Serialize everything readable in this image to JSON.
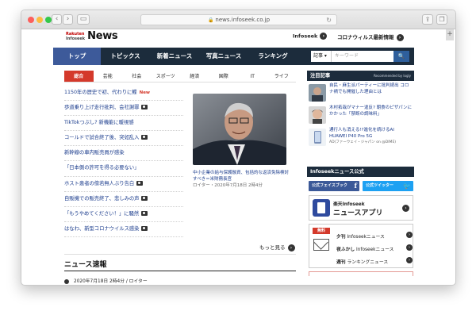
{
  "browser": {
    "url": "news.infoseek.co.jp",
    "back": "‹",
    "forward": "›",
    "reload": "↻",
    "new_tab": "+"
  },
  "header": {
    "logo_top": "Rakuten",
    "logo_bottom": "Infoseek",
    "logo_news": "News",
    "link_infoseek": "Infoseek",
    "link_corona": "コロナウィルス最新情報"
  },
  "gnav": {
    "items": [
      "トップ",
      "トピックス",
      "新着ニュース",
      "写真ニュース",
      "ランキング"
    ],
    "search_select": "記事 ▾",
    "search_placeholder": "キーワード",
    "search_button": "🔍"
  },
  "categories": [
    "総合",
    "芸能",
    "社会",
    "スポーツ",
    "経済",
    "国際",
    "IT",
    "ライフ"
  ],
  "articles": [
    {
      "title": "1150年の歴史で初、代わりに鰈",
      "camera": false,
      "new": "New"
    },
    {
      "title": "歩道乗り上げ走行批判、会社謝罪",
      "camera": true,
      "new": ""
    },
    {
      "title": "TikTokつぶし? 新機能に暖視感",
      "camera": false,
      "new": ""
    },
    {
      "title": "コールドで試合終了後、突如乱入",
      "camera": true,
      "new": ""
    },
    {
      "title": "新幹線の車内販売員が感染",
      "camera": false,
      "new": ""
    },
    {
      "title": "「日本側の許可を得る必要ない」",
      "camera": false,
      "new": ""
    },
    {
      "title": "ホスト患者の傍若無人ぶり告白",
      "camera": true,
      "new": ""
    },
    {
      "title": "自販機での販売終了、悲しみの声",
      "camera": true,
      "new": ""
    },
    {
      "title": "「もうやめてください！」に騒然",
      "camera": true,
      "new": ""
    },
    {
      "title": "はなわ、新型コロナウイルス感染",
      "camera": true,
      "new": ""
    }
  ],
  "featured": {
    "caption": "中小企業の給与保護融資、包括的な返済免除検討すべき＝米財務長官",
    "meta": "ロイター・2020年7月18日 2時4分"
  },
  "more_label": "もっと見る",
  "sokuho": {
    "title": "ニュース速報",
    "item": "2020年7月18日 2時4分 / ロイター"
  },
  "sidebar": {
    "chui_header": "注目記事",
    "recommended": "Recommended by logly",
    "chui": [
      {
        "text": "自民・麻生派パーティーに批判続出 コロナ禍でも開催した理由とは",
        "source": ""
      },
      {
        "text": "木村拓哉がマナー違反? 朝食のピザパンにかかった「禁断の調味料」",
        "source": ""
      },
      {
        "text": "通行人も消える!?進化を続けるAI HUAWEI P40 Pro 5G",
        "source": "AD(ファーウェイ・ジャパン on @DIME)"
      }
    ],
    "koushiki_header": "Infoseekニュース公式",
    "facebook": "公式フェイスブック",
    "twitter": "公式ツイッター",
    "app_top": "楽天Infoseek",
    "app_bottom": "ニュースアプリ",
    "mail_badge": "無料",
    "mail_rows": [
      {
        "bold": "夕刊",
        "text": " Infoseekニュース"
      },
      {
        "bold": "夜ふかし",
        "text": " Infoseekニュース"
      },
      {
        "bold": "週刊",
        "text": " ランキングニュース"
      }
    ]
  },
  "colors": {
    "nav_bg": "#1c2c3c",
    "nav_active": "#3d5a9a",
    "cat_active": "#d4392b",
    "facebook": "#3b5998",
    "twitter": "#1da1f2"
  }
}
